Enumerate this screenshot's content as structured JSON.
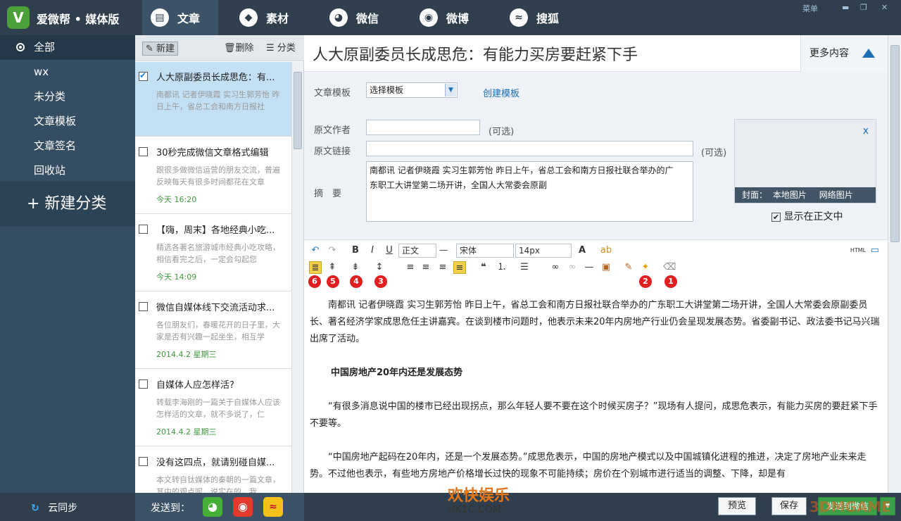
{
  "app": {
    "logo_letter": "V",
    "title": "爱微帮 • 媒体版"
  },
  "window": {
    "menu_label": "菜单",
    "minimize": "▬",
    "maximize": "❐",
    "close": "✕"
  },
  "nav": [
    {
      "label": "文章",
      "icon": "document-icon",
      "glyph": "▤"
    },
    {
      "label": "素材",
      "icon": "diamond-icon",
      "glyph": "◆"
    },
    {
      "label": "微信",
      "icon": "wechat-icon",
      "glyph": "◕"
    },
    {
      "label": "微博",
      "icon": "weibo-icon",
      "glyph": "◉"
    },
    {
      "label": "搜狐",
      "icon": "sohu-icon",
      "glyph": "≈"
    }
  ],
  "sidebar": {
    "items": [
      {
        "label": "全部"
      },
      {
        "label": "wx"
      },
      {
        "label": "未分类"
      },
      {
        "label": "文章模板"
      },
      {
        "label": "文章签名"
      },
      {
        "label": "回收站"
      }
    ],
    "new_category": "+ 新建分类"
  },
  "list_toolbar": {
    "new": "新建",
    "delete": "删除",
    "category": "分类"
  },
  "articles": [
    {
      "title": "人大原副委员长成思危：有...",
      "summary": "南都讯 记者伊晓霞 实习生郭芳怡 昨日上午，省总工会和南方日报社",
      "date": "",
      "checked": true
    },
    {
      "title": "30秒完成微信文章格式编辑",
      "summary": "跟很多做微信运营的朋友交流，普遍反映每天有很多时间都花在文章",
      "date": "今天 16:20",
      "checked": false
    },
    {
      "title": "【嗨，周末】各地经典小吃...",
      "summary": "精选各著名旅游城市经典小吃攻略，相信看完之后，一定会勾起您",
      "date": "今天 14:09",
      "checked": false
    },
    {
      "title": "微信自媒体线下交流活动求...",
      "summary": "各位朋友们，春暖花开的日子里，大家是否有兴趣一起坐坐，相互学",
      "date": "2014.4.2 星期三",
      "checked": false
    },
    {
      "title": "自媒体人应怎样活?",
      "summary": "转载李海刚的一篇关于自媒体人应该怎样活的文章，就不多说了，仁",
      "date": "2014.4.2 星期三",
      "checked": false
    },
    {
      "title": "没有这四点，就请别碰自媒...",
      "summary": "本文转自钛媒体的秦朝的一篇文章，其中的观点呢，说实在的，我",
      "date": "",
      "checked": false
    }
  ],
  "editor": {
    "title": "人大原副委员长成思危：有能力买房要赶紧下手",
    "more": "更多内容",
    "template_label": "文章模板",
    "template_value": "选择模板",
    "create_template": "创建模板",
    "author_label": "原文作者",
    "author_value": "",
    "optional": "(可选)",
    "link_label": "原文链接",
    "link_value": "",
    "summary_label": "摘　要",
    "summary_value": "南都讯 记者伊晓霞 实习生郭芳怡 昨日上午，省总工会和南方日报社联合举办的广东职工大讲堂第二场开讲，全国人大常委会原副",
    "cover_label": "封面：",
    "cover_local": "本地图片",
    "cover_web": "网络图片",
    "cover_close": "x",
    "show_in_body": "显示在正文中"
  },
  "toolbar": {
    "paragraph": "正文",
    "dash": "—",
    "font": "宋体",
    "size": "14px",
    "html": "HTML",
    "badges": [
      "6",
      "5",
      "4",
      "3",
      "2",
      "1"
    ]
  },
  "content": {
    "p1": "南都讯 记者伊晓霞 实习生郭芳怡 昨日上午，省总工会和南方日报社联合举办的广东职工大讲堂第二场开讲，全国人大常委会原副委员长、著名经济学家成思危任主讲嘉宾。在谈到楼市问题时，他表示未来20年内房地产行业仍会呈现发展态势。省委副书记、政法委书记马兴瑞出席了活动。",
    "h1": "中国房地产20年内还是发展态势",
    "p2": "“有很多消息说中国的楼市已经出现拐点，那么年轻人要不要在这个时候买房子？”现场有人提问，成思危表示，有能力买房的要赶紧下手不要等。",
    "p3": "“中国房地产起码在20年内，还是一个发展态势。”成思危表示，中国的房地产模式以及中国城镇化进程的推进，决定了房地产业未来走势。不过他也表示，有些地方房地产价格增长过快的现象不可能持续；房价在个别城市进行适当的调整、下降，却是有"
  },
  "bottom": {
    "sync": "云同步",
    "send_to": "发送到：",
    "preview": "预览",
    "save": "保存",
    "send_wechat": "发送到微信"
  },
  "watermarks": {
    "brand": "欢快娱乐",
    "domain": "HK1C.COM",
    "game": "3DMGAME"
  }
}
